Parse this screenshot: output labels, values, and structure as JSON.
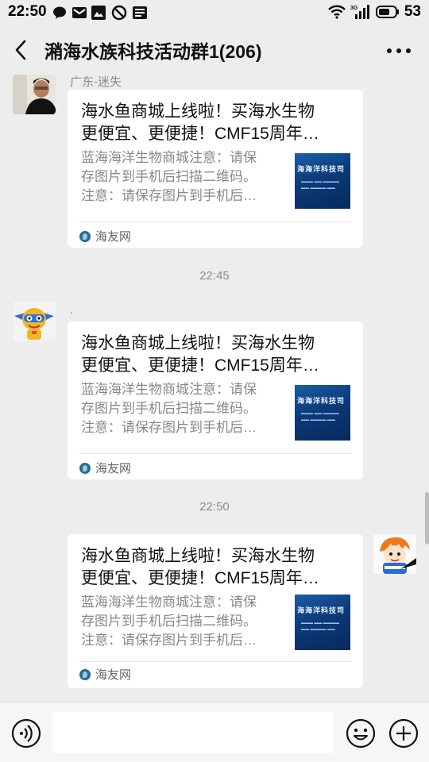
{
  "status_bar": {
    "time": "22:50",
    "network": "3G",
    "battery": "53"
  },
  "header": {
    "title": "潲海水族科技活动群1(206)"
  },
  "messages": [
    {
      "sender": "广东-迷失",
      "side": "left",
      "card": {
        "title_line1": "海水鱼商城上线啦！买海水生物",
        "title_line2": "更便宜、更便捷！CMF15周年…",
        "desc_line1": "蓝海海洋生物商城注意：请保",
        "desc_line2": "存图片到手机后扫描二维码。",
        "desc_line3": "注意：请保存图片到手机后…",
        "thumb_text": "海海洋科技司",
        "source": "海友网"
      }
    },
    {
      "time": "22:45",
      "sender": ".",
      "side": "left",
      "card": {
        "title_line1": "海水鱼商城上线啦！买海水生物",
        "title_line2": "更便宜、更便捷！CMF15周年…",
        "desc_line1": "蓝海海洋生物商城注意：请保",
        "desc_line2": "存图片到手机后扫描二维码。",
        "desc_line3": "注意：请保存图片到手机后…",
        "thumb_text": "海海洋科技司",
        "source": "海友网"
      }
    },
    {
      "time": "22:50",
      "side": "right",
      "card": {
        "title_line1": "海水鱼商城上线啦！买海水生物",
        "title_line2": "更便宜、更便捷！CMF15周年…",
        "desc_line1": "蓝海海洋生物商城注意：请保",
        "desc_line2": "存图片到手机后扫描二维码。",
        "desc_line3": "注意：请保存图片到手机后…",
        "thumb_text": "海海洋科技司",
        "source": "海友网"
      }
    }
  ],
  "input_bar": {
    "placeholder": ""
  },
  "colors": {
    "background": "#ededed",
    "card": "#ffffff",
    "thumb_blue": "#0c3a78"
  },
  "icons": [
    "wechat-icon",
    "mail-icon",
    "image-icon",
    "block-icon",
    "news-icon",
    "wifi-icon",
    "signal-icon",
    "battery-icon",
    "back-icon",
    "more-icon",
    "voice-icon",
    "emoji-icon",
    "plus-icon"
  ]
}
